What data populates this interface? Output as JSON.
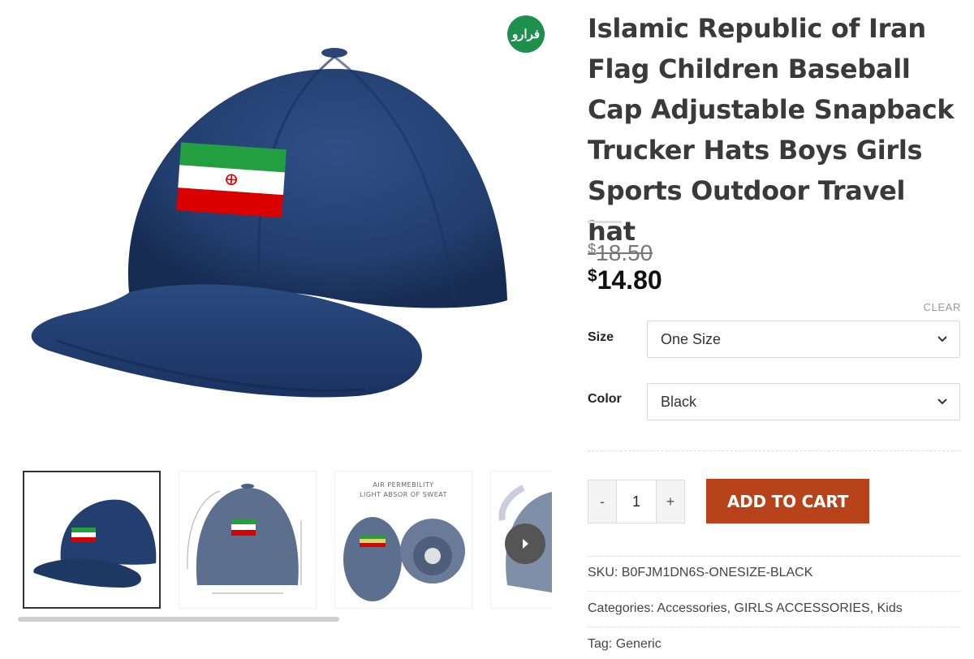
{
  "product": {
    "title": "Islamic Republic of Iran Flag Children Baseball Cap Adjustable Snapback Trucker Hats Boys Girls Sports Outdoor Travel hat",
    "price_old_currency": "$",
    "price_old": "18.50",
    "price_new_currency": "$",
    "price_new": "14.80"
  },
  "brand": {
    "badge_text": "فرارو"
  },
  "variations": {
    "clear_label": "CLEAR",
    "size_label": "Size",
    "size_value": "One Size",
    "color_label": "Color",
    "color_value": "Black"
  },
  "cart": {
    "minus": "-",
    "quantity": "1",
    "plus": "+",
    "add_label": "ADD TO CART"
  },
  "meta": {
    "sku_label": "SKU:",
    "sku_value": "B0FJM1DN6S-ONESIZE-BLACK",
    "categories_label": "Categories:",
    "categories": [
      "Accessories",
      "GIRLS ACCESSORIES",
      "Kids"
    ],
    "tag_label": "Tag:",
    "tag_value": "Generic"
  },
  "gallery": {
    "thumb3_caption_line1": "AIR PERMEBILITY",
    "thumb3_caption_line2": "LIGHT ABSOR OF SWEAT",
    "next_icon": "chevron-right",
    "colors": {
      "cap_navy": "#233f6f",
      "cap_gray": "#5c6f8f",
      "flag_green": "#239f40",
      "flag_red": "#da0000"
    }
  },
  "colors": {
    "accent_button": "#b8421a",
    "title": "#3a3a3a",
    "badge": "#1f8f4e"
  }
}
